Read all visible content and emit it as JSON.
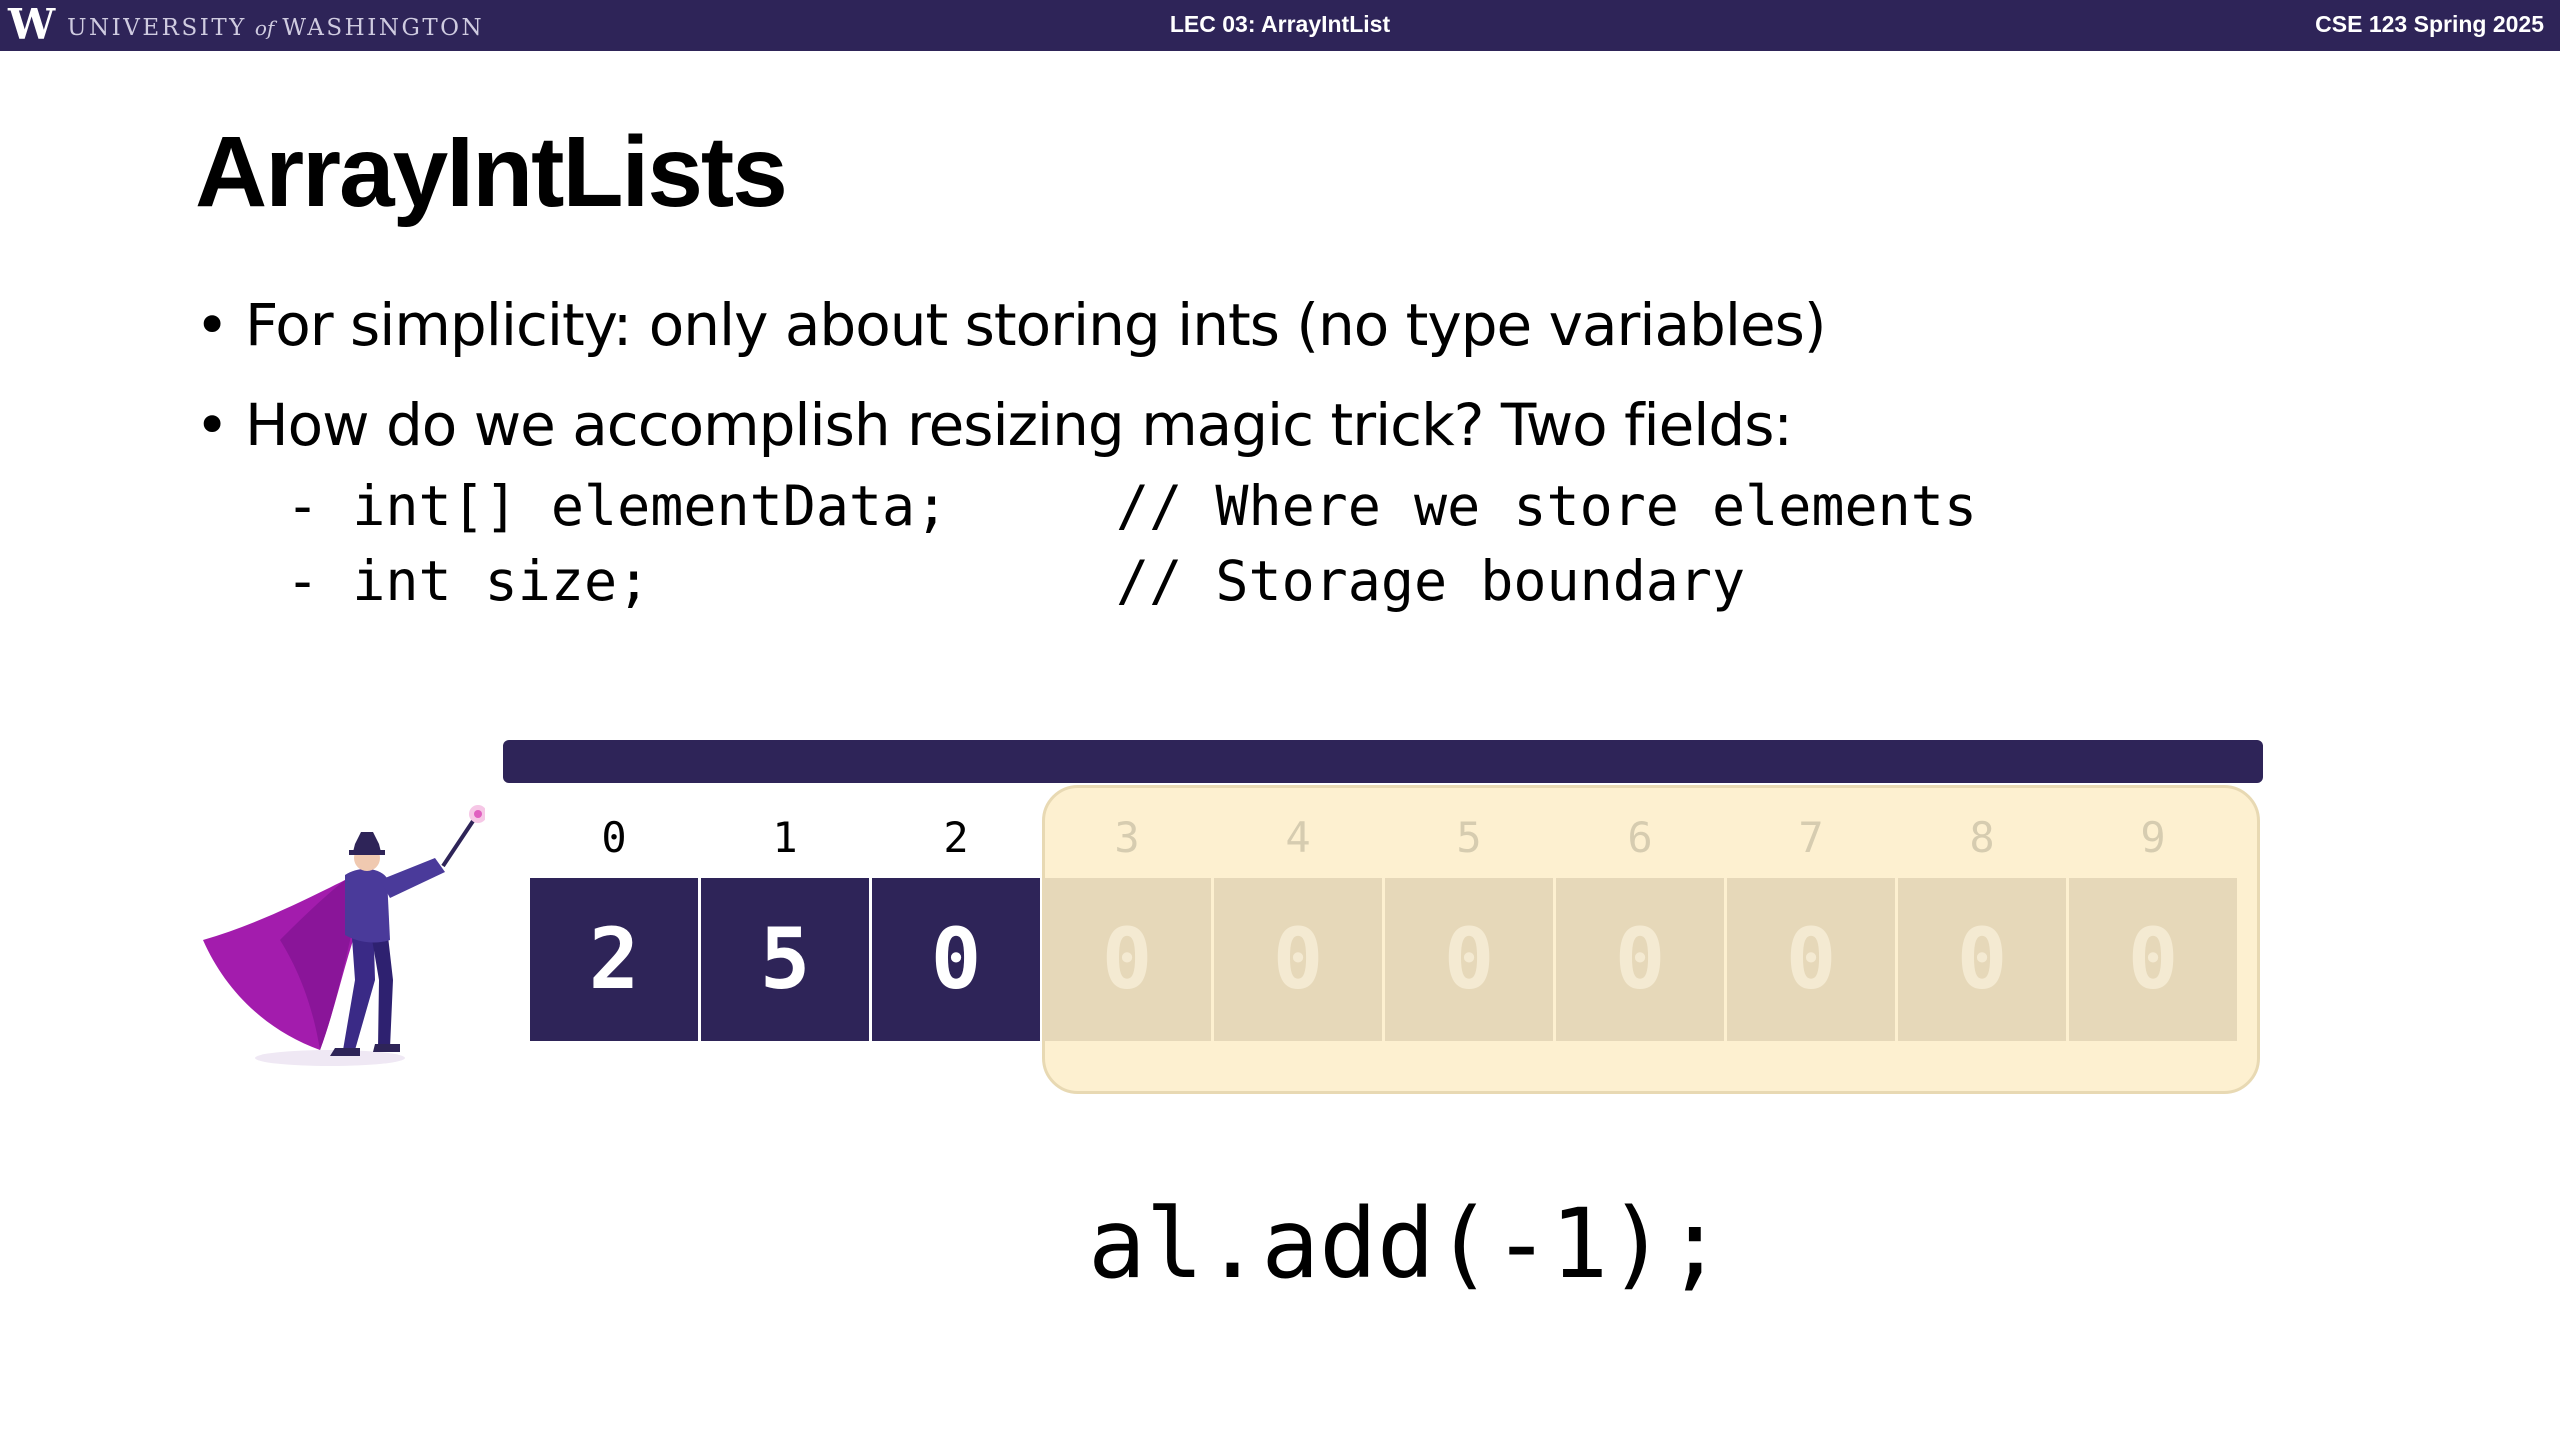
{
  "header": {
    "logo_letter": "W",
    "university_text_1": "UNIVERSITY",
    "university_text_of": "of",
    "university_text_2": "WASHINGTON",
    "lecture_title": "LEC 03: ArrayIntList",
    "course": "CSE 123 Spring 2025"
  },
  "slide": {
    "title": "ArrayIntLists",
    "bullets": [
      "For simplicity: only about storing ints (no type variables)",
      "How do we accomplish resizing magic trick? Two fields:"
    ],
    "bullet_marker": "•",
    "code_lines": [
      {
        "dash": "- ",
        "code": "int[] elementData;",
        "comment": "// Where we store elements"
      },
      {
        "dash": "- ",
        "code": "int size;",
        "comment": "// Storage boundary"
      }
    ],
    "array": {
      "indices": [
        "0",
        "1",
        "2",
        "3",
        "4",
        "5",
        "6",
        "7",
        "8",
        "9"
      ],
      "values": [
        "2",
        "5",
        "0",
        "0",
        "0",
        "0",
        "0",
        "0",
        "0",
        "0"
      ],
      "size": 3,
      "capacity": 10
    },
    "call": "al.add(-1);"
  },
  "colors": {
    "header_bg": "#2e2458",
    "cell_filled": "#2e2458",
    "cell_unused": "#e6d8b9",
    "unused_region": "#fdf0d0",
    "cape": "#a31cad"
  },
  "icons": {
    "magician": "magician-with-wand-icon"
  }
}
